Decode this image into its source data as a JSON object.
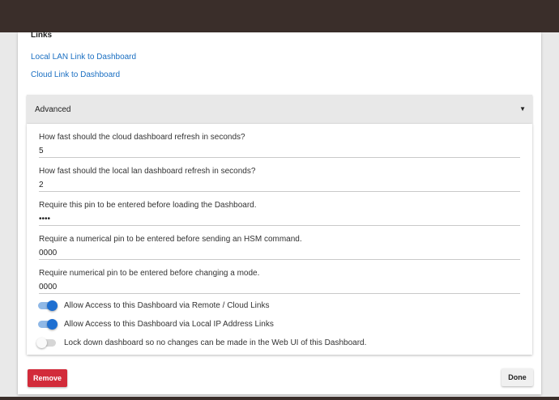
{
  "links": {
    "heading": "Links",
    "lan_link": "Local LAN Link to Dashboard",
    "cloud_link": "Cloud Link to Dashboard"
  },
  "advanced": {
    "title": "Advanced",
    "caret": "▼",
    "fields": [
      {
        "label": "How fast should the cloud dashboard refresh in seconds?",
        "value": "5"
      },
      {
        "label": "How fast should the local lan dashboard refresh in seconds?",
        "value": "2"
      },
      {
        "label": "Require this pin to be entered before loading the Dashboard.",
        "value": "••••"
      },
      {
        "label": "Require a numerical pin to be entered before sending an HSM command.",
        "value": "0000"
      },
      {
        "label": "Require numerical pin to be entered before changing a mode.",
        "value": "0000"
      }
    ],
    "toggles": [
      {
        "label": "Allow Access to this Dashboard via Remote / Cloud Links",
        "state": "on"
      },
      {
        "label": "Allow Access to this Dashboard via Local IP Address Links",
        "state": "on"
      },
      {
        "label": "Lock down dashboard so no changes can be made in the Web UI of this Dashboard.",
        "state": "off"
      }
    ]
  },
  "footer": {
    "remove_label": "Remove",
    "done_label": "Done"
  },
  "colors": {
    "topbar": "#3a2e2a",
    "link": "#1a6fc2",
    "toggle_on": "#1e6fd1",
    "remove_button": "#d22b3a"
  }
}
